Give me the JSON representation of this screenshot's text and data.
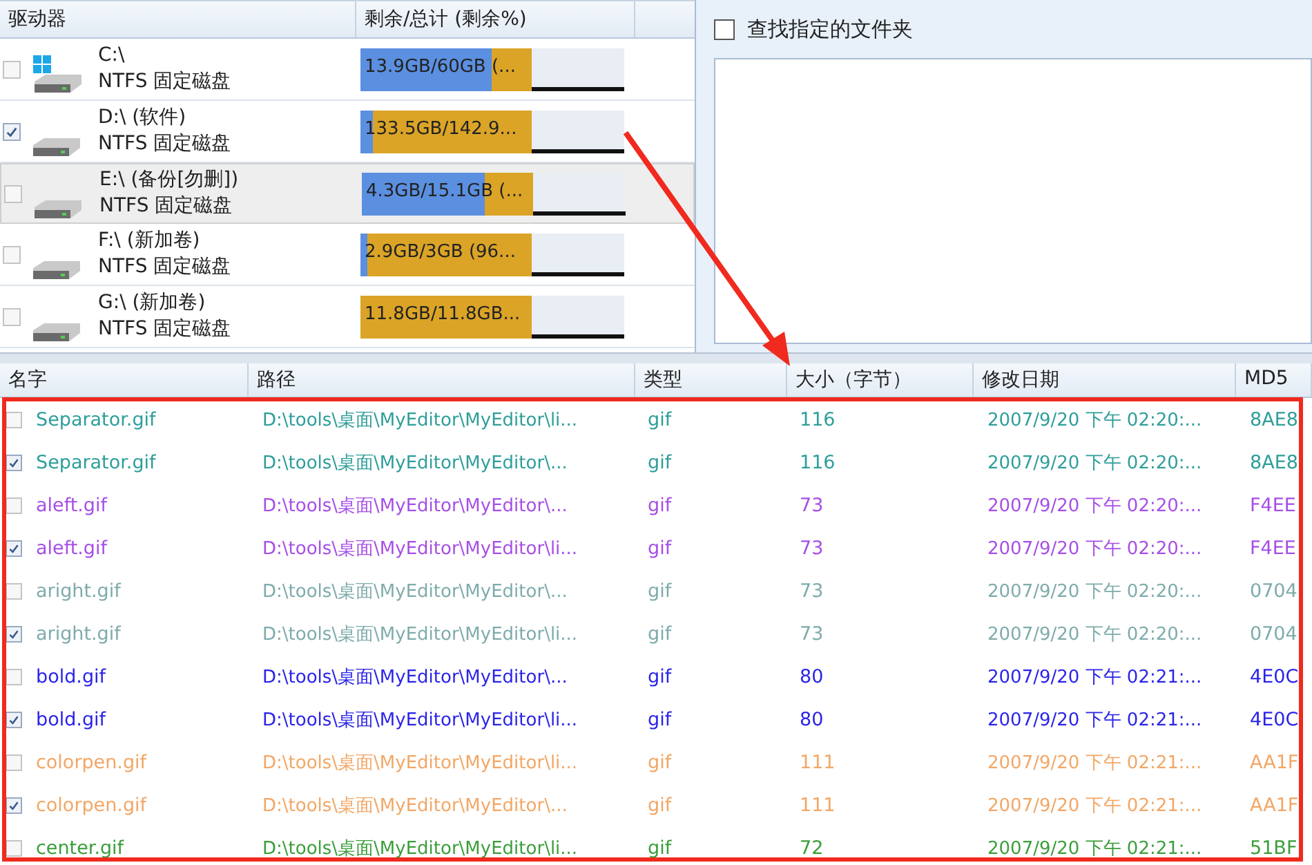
{
  "drives": {
    "columns": [
      "驱动器",
      "剩余/总计 (剩余%)"
    ],
    "items": [
      {
        "kind": "system",
        "name": "C:\\",
        "fs": "NTFS 固定磁盘",
        "checked": false,
        "selected": false,
        "usage": "13.9GB/60GB (...",
        "level": 0.77
      },
      {
        "kind": "data",
        "name": "D:\\ (软件)",
        "fs": "NTFS 固定磁盘",
        "checked": true,
        "selected": false,
        "usage": "133.5GB/142.9...",
        "level": 0.07
      },
      {
        "kind": "data",
        "name": "E:\\ (备份[勿删])",
        "fs": "NTFS 固定磁盘",
        "checked": false,
        "selected": true,
        "usage": "4.3GB/15.1GB (...",
        "level": 0.72
      },
      {
        "kind": "data",
        "name": "F:\\ (新加卷)",
        "fs": "NTFS 固定磁盘",
        "checked": false,
        "selected": false,
        "usage": "2.9GB/3GB (96...",
        "level": 0.04
      },
      {
        "kind": "data",
        "name": "G:\\ (新加卷)",
        "fs": "NTFS 固定磁盘",
        "checked": false,
        "selected": false,
        "usage": "11.8GB/11.8GB...",
        "level": 0.0
      }
    ]
  },
  "folder_filter": {
    "label": "查找指定的文件夹",
    "checked": false
  },
  "files": {
    "columns": [
      "名字",
      "路径",
      "类型",
      "大小（字节）",
      "修改日期",
      "MD5"
    ],
    "rows": [
      {
        "checked": false,
        "color": "#2e9e9a",
        "name": "Separator.gif",
        "path": "D:\\tools\\桌面\\MyEditor\\MyEditor\\li...",
        "type": "gif",
        "size": "116",
        "date": "2007/9/20 下午 02:20:...",
        "md5": "8AE8"
      },
      {
        "checked": true,
        "color": "#2e9e9a",
        "name": "Separator.gif",
        "path": "D:\\tools\\桌面\\MyEditor\\MyEditor\\...",
        "type": "gif",
        "size": "116",
        "date": "2007/9/20 下午 02:20:...",
        "md5": "8AE8"
      },
      {
        "checked": false,
        "color": "#a64fe6",
        "name": "aleft.gif",
        "path": "D:\\tools\\桌面\\MyEditor\\MyEditor\\...",
        "type": "gif",
        "size": "73",
        "date": "2007/9/20 下午 02:20:...",
        "md5": "F4EE"
      },
      {
        "checked": true,
        "color": "#a64fe6",
        "name": "aleft.gif",
        "path": "D:\\tools\\桌面\\MyEditor\\MyEditor\\li...",
        "type": "gif",
        "size": "73",
        "date": "2007/9/20 下午 02:20:...",
        "md5": "F4EE"
      },
      {
        "checked": false,
        "color": "#7fabab",
        "name": "aright.gif",
        "path": "D:\\tools\\桌面\\MyEditor\\MyEditor\\...",
        "type": "gif",
        "size": "73",
        "date": "2007/9/20 下午 02:20:...",
        "md5": "0704"
      },
      {
        "checked": true,
        "color": "#7fabab",
        "name": "aright.gif",
        "path": "D:\\tools\\桌面\\MyEditor\\MyEditor\\li...",
        "type": "gif",
        "size": "73",
        "date": "2007/9/20 下午 02:20:...",
        "md5": "0704"
      },
      {
        "checked": false,
        "color": "#2b24e8",
        "name": "bold.gif",
        "path": "D:\\tools\\桌面\\MyEditor\\MyEditor\\...",
        "type": "gif",
        "size": "80",
        "date": "2007/9/20 下午 02:21:...",
        "md5": "4E0C"
      },
      {
        "checked": true,
        "color": "#2b24e8",
        "name": "bold.gif",
        "path": "D:\\tools\\桌面\\MyEditor\\MyEditor\\li...",
        "type": "gif",
        "size": "80",
        "date": "2007/9/20 下午 02:21:...",
        "md5": "4E0C"
      },
      {
        "checked": false,
        "color": "#f2a766",
        "name": "colorpen.gif",
        "path": "D:\\tools\\桌面\\MyEditor\\MyEditor\\li...",
        "type": "gif",
        "size": "111",
        "date": "2007/9/20 下午 02:21:...",
        "md5": "AA1F"
      },
      {
        "checked": true,
        "color": "#f2a766",
        "name": "colorpen.gif",
        "path": "D:\\tools\\桌面\\MyEditor\\MyEditor\\...",
        "type": "gif",
        "size": "111",
        "date": "2007/9/20 下午 02:21:...",
        "md5": "AA1F"
      },
      {
        "checked": false,
        "color": "#3a9e3a",
        "name": "center.gif",
        "path": "D:\\tools\\桌面\\MyEditor\\MyEditor\\li...",
        "type": "gif",
        "size": "72",
        "date": "2007/9/20 下午 02:21:...",
        "md5": "51BF"
      }
    ]
  }
}
